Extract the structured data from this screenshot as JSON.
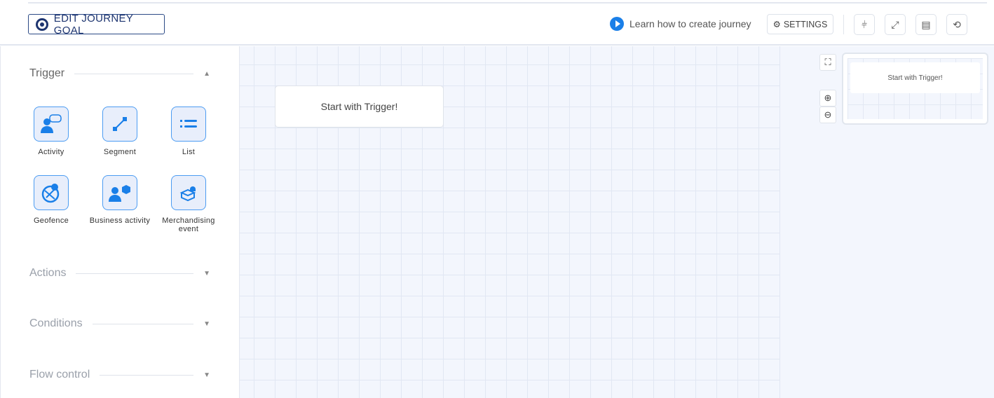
{
  "header": {
    "edit_goal": "EDIT JOURNEY GOAL",
    "learn": "Learn how to create journey",
    "settings": "SETTINGS"
  },
  "sidebar": {
    "trigger": {
      "title": "Trigger",
      "items": [
        {
          "label": "Activity"
        },
        {
          "label": "Segment"
        },
        {
          "label": "List"
        },
        {
          "label": "Geofence"
        },
        {
          "label": "Business activity"
        },
        {
          "label": "Merchandising event"
        }
      ]
    },
    "actions": "Actions",
    "conditions": "Conditions",
    "flow_control": "Flow control"
  },
  "canvas": {
    "start_node": "Start with Trigger!",
    "minimap_node": "Start with Trigger!"
  },
  "colors": {
    "accent": "#1a7fe8",
    "goal": "#1e3570"
  }
}
